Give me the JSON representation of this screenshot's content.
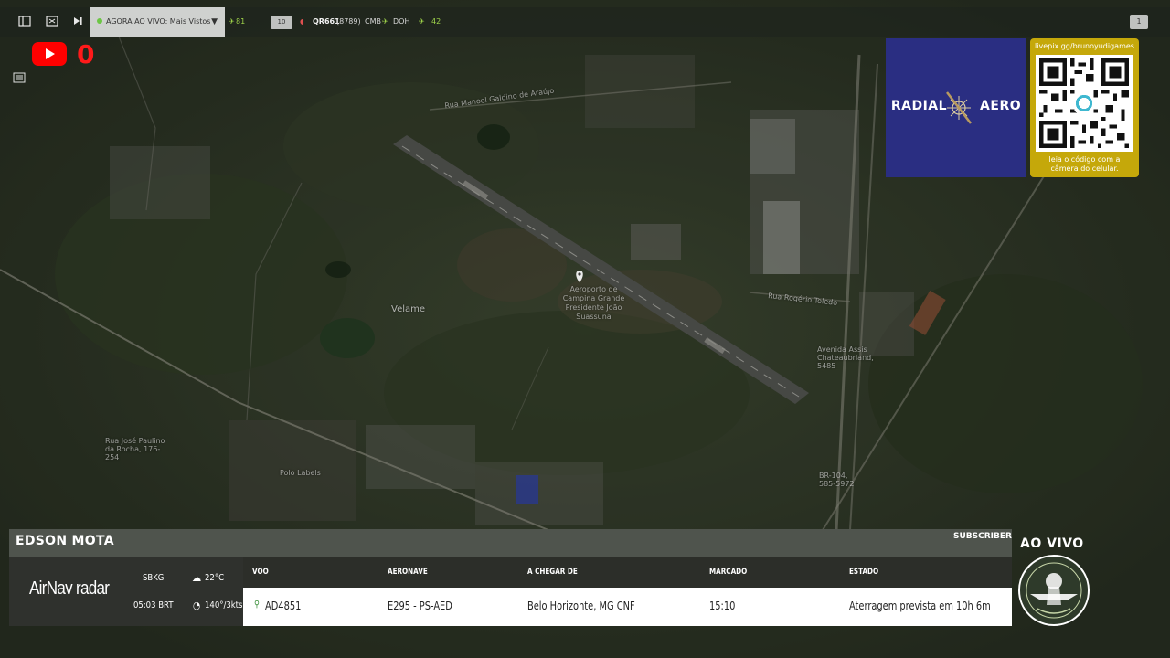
{
  "toolbar": {
    "live_select_label": "AGORA AO VIVO: Mais Vistos",
    "count_green": "81",
    "box_count": "10",
    "flight_code": "QR661",
    "flight_code_extra": "(8789)",
    "route_from": "CMB",
    "route_to": "DOH",
    "count_green_2": "42",
    "corner_badge": "1"
  },
  "youtube": {
    "count": "0"
  },
  "map": {
    "labels": {
      "airport": "Aeroporto de Campina Grande Presidente João Suassuna",
      "velame": "Velame",
      "street_1": "Rua Manoel Galdino de Araújo",
      "street_2": "Rua Rogério Toledo",
      "street_3": "Avenida Assis Chateaubriand, 5485",
      "street_4": "Rua José Paulino da Rocha, 176-254",
      "street_5": "Polo Labels",
      "street_6": "BR-104, 585-5972"
    }
  },
  "sponsor": {
    "radial_left": "RADIAL",
    "radial_right": "AERO",
    "qr_url": "livepix.gg/brunoyudigames",
    "qr_caption_1": "leia o código com a",
    "qr_caption_2": "câmera do celular."
  },
  "panel": {
    "announcer": "EDSON MOTA",
    "subscriber": "SUBSCRIBER",
    "brand": "AirNav radar",
    "airport_code": "SBKG",
    "temperature": "22°C",
    "local_time": "05:03 BRT",
    "wind": "140°/3kts",
    "headers": {
      "flight": "VOO",
      "aircraft": "AERONAVE",
      "from": "A CHEGAR DE",
      "scheduled": "MARCADO",
      "status": "ESTADO"
    },
    "row": {
      "flight": "AD4851",
      "aircraft": "E295 - PS-AED",
      "from": "Belo Horizonte, MG CNF",
      "scheduled": "15:10",
      "status": "Aterragem prevista em 10h 6m"
    }
  },
  "live": {
    "label": "AO VIVO"
  },
  "colors": {
    "youtube_red": "#ff0000",
    "radial_blue": "#2a2e82",
    "qr_gold": "#c5a80a",
    "live_green": "#9fd34a"
  }
}
